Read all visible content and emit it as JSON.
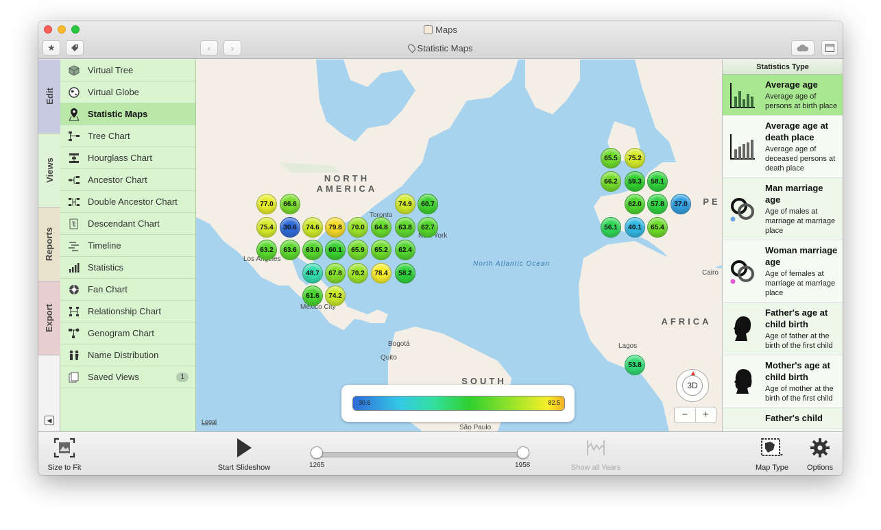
{
  "window": {
    "title": "Maps",
    "subtitle": "Statistic Maps"
  },
  "toolbar": {
    "favorites_icon": "star-icon",
    "tag_icon": "tag-icon",
    "back_icon": "chevron-left-icon",
    "forward_icon": "chevron-right-icon",
    "cloud_icon": "cloud-icon",
    "sidebar_toggle_icon": "panel-icon"
  },
  "vtabs": [
    "Edit",
    "Views",
    "Reports",
    "Export"
  ],
  "sidebar": {
    "items": [
      {
        "label": "Virtual Tree",
        "icon": "cube-icon"
      },
      {
        "label": "Virtual Globe",
        "icon": "globe-icon"
      },
      {
        "label": "Statistic Maps",
        "icon": "map-pin-icon",
        "selected": true
      },
      {
        "label": "Tree Chart",
        "icon": "tree-chart-icon"
      },
      {
        "label": "Hourglass Chart",
        "icon": "hourglass-chart-icon"
      },
      {
        "label": "Ancestor Chart",
        "icon": "ancestor-chart-icon"
      },
      {
        "label": "Double Ancestor Chart",
        "icon": "double-ancestor-chart-icon"
      },
      {
        "label": "Descendant Chart",
        "icon": "descendant-chart-icon"
      },
      {
        "label": "Timeline",
        "icon": "timeline-icon"
      },
      {
        "label": "Statistics",
        "icon": "statistics-icon"
      },
      {
        "label": "Fan Chart",
        "icon": "fan-chart-icon"
      },
      {
        "label": "Relationship Chart",
        "icon": "relationship-chart-icon"
      },
      {
        "label": "Genogram Chart",
        "icon": "genogram-chart-icon"
      },
      {
        "label": "Name Distribution",
        "icon": "name-distribution-icon"
      },
      {
        "label": "Saved Views",
        "icon": "saved-views-icon",
        "badge": "1"
      }
    ]
  },
  "map": {
    "region_labels": {
      "north_america": "NORTH AMERICA",
      "south_america": "SOUTH AMERICA",
      "africa": "AFRICA",
      "europe_fragment": "PE"
    },
    "ocean_label": "North Atlantic Ocean",
    "cities": [
      "Toronto",
      "New York",
      "Los Angeles",
      "Mexico City",
      "Bogotá",
      "Quito",
      "Lagos",
      "Cairo",
      "São Paulo"
    ],
    "legal": "Legal",
    "compass_label": "3D",
    "zoom_out": "−",
    "zoom_in": "+",
    "legend": {
      "min": "30.6",
      "max": "82.5"
    },
    "bubbles": [
      "77.0",
      "66.6",
      "74.9",
      "60.7",
      "75.4",
      "30.6",
      "74.6",
      "79.8",
      "70.0",
      "64.8",
      "63.8",
      "62.7",
      "63.2",
      "63.6",
      "63.0",
      "60.1",
      "65.9",
      "65.2",
      "62.4",
      "48.7",
      "67.8",
      "70.2",
      "78.4",
      "58.2",
      "61.6",
      "74.2",
      "65.5",
      "75.2",
      "66.2",
      "59.3",
      "58.1",
      "62.0",
      "57.8",
      "37.0",
      "56.1",
      "40.1",
      "65.4",
      "53.8"
    ]
  },
  "statistics_panel": {
    "header": "Statistics Type",
    "items": [
      {
        "title": "Average age",
        "desc": "Average age of persons at birth place",
        "icon": "bar-chart-icon",
        "selected": true
      },
      {
        "title": "Average age at death place",
        "desc": "Average age of deceased persons at death place",
        "icon": "bar-chart-gray-icon"
      },
      {
        "title": "Man marriage age",
        "desc": "Age of males at marriage at marriage place",
        "icon": "rings-male-icon"
      },
      {
        "title": "Woman marriage age",
        "desc": "Age of females at marriage at marriage place",
        "icon": "rings-female-icon"
      },
      {
        "title": "Father's age at child birth",
        "desc": "Age of father at the birth of the first child",
        "icon": "male-silhouette-icon"
      },
      {
        "title": "Mother's age at child birth",
        "desc": "Age of mother at the birth of the first child",
        "icon": "female-silhouette-icon"
      },
      {
        "title": "Father's child",
        "desc": "",
        "icon": "male-silhouette-icon"
      }
    ]
  },
  "bottom": {
    "size_to_fit": "Size to Fit",
    "start_slideshow": "Start Slideshow",
    "year_start": "1265",
    "year_end": "1958",
    "show_all_years": "Show all Years",
    "map_type": "Map Type",
    "options": "Options"
  }
}
